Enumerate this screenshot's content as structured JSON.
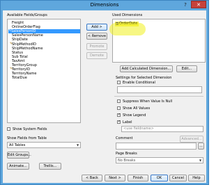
{
  "window": {
    "title": "Dimensions",
    "help": "?",
    "close": "✕"
  },
  "left": {
    "available_label": "Available Fields/Groups",
    "fields": [
      {
        "label": "Freight",
        "icon": false,
        "selected": false
      },
      {
        "label": "OnlineOrderFlag",
        "icon": false,
        "selected": false
      },
      {
        "label": "SalesPersonID",
        "icon": true,
        "selected": true
      },
      {
        "label": "SalesPersonName",
        "icon": false,
        "selected": false
      },
      {
        "label": "ShipDate",
        "icon": false,
        "selected": false
      },
      {
        "label": "ShipMethodID",
        "icon": true,
        "selected": false
      },
      {
        "label": "ShipMethodName",
        "icon": false,
        "selected": false
      },
      {
        "label": "Status",
        "icon": false,
        "selected": false
      },
      {
        "label": "Sub Total",
        "icon": false,
        "selected": false
      },
      {
        "label": "TaxAmt",
        "icon": false,
        "selected": false
      },
      {
        "label": "TerritoryGroup",
        "icon": false,
        "selected": false
      },
      {
        "label": "TerritoryID",
        "icon": true,
        "selected": false
      },
      {
        "label": "TerritoryName",
        "icon": false,
        "selected": false
      },
      {
        "label": "TotalDue",
        "icon": false,
        "selected": false
      }
    ],
    "show_system_fields": "Show System Fields",
    "show_from_table_label": "Show Fields from Table",
    "table_select_value": "All Tables",
    "edit_groups": "Edit Groups...",
    "animate": "Animate...",
    "trellis": "Trellis..."
  },
  "middle": {
    "add": "Add >",
    "remove": "< Remove",
    "promote": "Promote",
    "demote": "Demote"
  },
  "right": {
    "used_label": "Used Dimensions",
    "used_items": [
      "OrderDate"
    ],
    "add_calculated": "Add Calculated Dimension...",
    "edit": "Edit...",
    "settings_label": "Settings for Selected Dimension",
    "enable_conditional": "Enable Conditional",
    "suppress_null": "Suppress When Value Is Null",
    "show_all_values": "Show All Values",
    "show_legend": "Show Legend",
    "show_legend_checked": true,
    "label": "Label",
    "label_checked": true,
    "label_placeholder": "<use fieldname>",
    "advanced": "Advanced...",
    "comment_label": "Comment",
    "page_breaks_label": "Page Breaks",
    "page_breaks_value": "No Breaks",
    "ellipsis": "..."
  },
  "footer": {
    "back": "< Back",
    "next": "Next >",
    "finish": "Finish",
    "ok": "OK",
    "cancel": "Cancel",
    "help": "Help"
  }
}
